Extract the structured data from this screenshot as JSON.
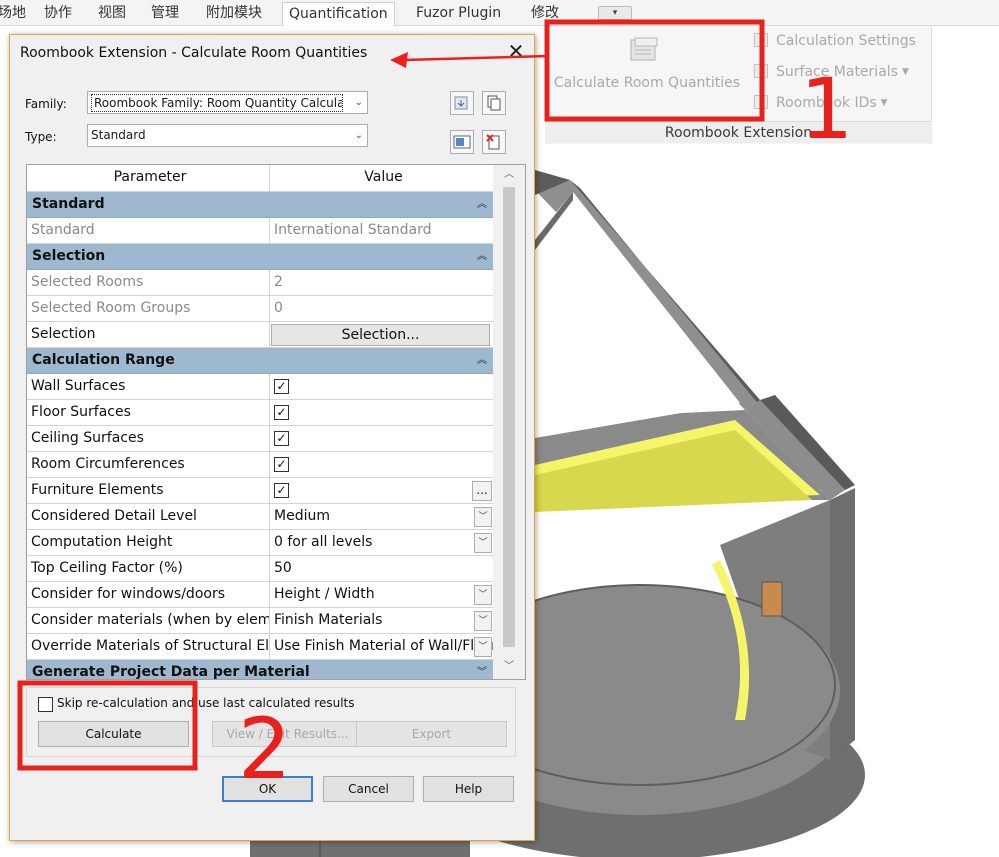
{
  "ribbon": {
    "tabs": [
      "场地",
      "协作",
      "视图",
      "管理",
      "附加模块",
      "Quantification",
      "Fuzor Plugin",
      "修改"
    ],
    "active_tab": "Quantification",
    "quick_access": "▾",
    "panel_title": "Roombook Extension",
    "big_button": "Calculate Room Quantities",
    "small_buttons": [
      "Calculation Settings",
      "Surface Materials",
      "Roombook IDs"
    ]
  },
  "dialog": {
    "title": "Roombook Extension - Calculate Room Quantities",
    "family_label": "Family:",
    "family_value": "Roombook Family: Room Quantity Calculation",
    "type_label": "Type:",
    "type_value": "Standard",
    "grid": {
      "header": {
        "parameter": "Parameter",
        "value": "Value"
      },
      "groups": {
        "standard": "Standard",
        "selection": "Selection",
        "calc_range": "Calculation Range",
        "generate": "Generate Project Data per Material"
      },
      "rows": {
        "standard": {
          "label": "Standard",
          "value": "International Standard"
        },
        "selected_rooms": {
          "label": "Selected Rooms",
          "value": "2"
        },
        "selected_room_groups": {
          "label": "Selected Room Groups",
          "value": "0"
        },
        "selection": {
          "label": "Selection",
          "button": "Selection..."
        },
        "wall_surfaces": {
          "label": "Wall Surfaces",
          "checked": true
        },
        "floor_surfaces": {
          "label": "Floor Surfaces",
          "checked": true
        },
        "ceiling_surfaces": {
          "label": "Ceiling Surfaces",
          "checked": true
        },
        "room_circumferences": {
          "label": "Room Circumferences",
          "checked": true
        },
        "furniture_elements": {
          "label": "Furniture Elements",
          "checked": true,
          "button": "..."
        },
        "detail_level": {
          "label": "Considered Detail Level",
          "value": "Medium"
        },
        "computation_height": {
          "label": "Computation Height",
          "value": "0 for all levels"
        },
        "top_ceiling_factor": {
          "label": "Top Ceiling Factor (%)",
          "value": "50"
        },
        "windows_doors": {
          "label": "Consider for windows/doors",
          "value": "Height / Width"
        },
        "consider_materials": {
          "label": "Consider materials (when by element)",
          "value": "Finish Materials"
        },
        "override_materials": {
          "label": "Override Materials of Structural Elements",
          "value": "Use Finish Material of Wall/Floor"
        }
      }
    },
    "skip_label": "Skip re-calculation and use last calculated results",
    "skip_checked": false,
    "buttons": {
      "calculate": "Calculate",
      "view_edit": "View / Edit Results...",
      "export": "Export",
      "ok": "OK",
      "cancel": "Cancel",
      "help": "Help"
    }
  },
  "annotations": {
    "mark1": "1",
    "mark2": "2",
    "highlight_color": "#e8211d"
  },
  "colors": {
    "group_header": "#9eb8cf",
    "wall_grey": "#7c7c7c",
    "finish_yellow": "#f5f56a",
    "door_brown": "#c88a4e",
    "dialog_border": "#e8a33d"
  }
}
